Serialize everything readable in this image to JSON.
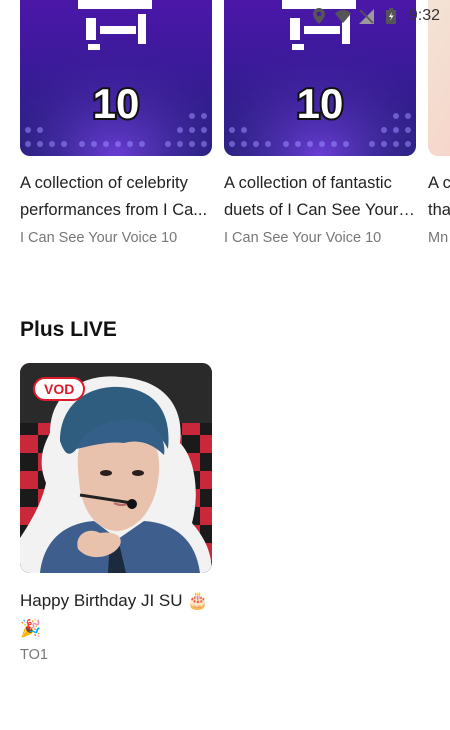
{
  "status_bar": {
    "time": "9:32"
  },
  "carousel": {
    "cards": [
      {
        "title": "A collection of celebrity performances from I Ca...",
        "subtitle": "I Can See Your Voice 10",
        "thumb_text": "10"
      },
      {
        "title": "A collection of fantastic duets of I Can See Your ...",
        "subtitle": "I Can See Your Voice 10",
        "thumb_text": "10"
      },
      {
        "title": "A c tha",
        "subtitle": "Mn"
      }
    ]
  },
  "plus_live": {
    "section_title": "Plus LIVE",
    "items": [
      {
        "badge": "VOD",
        "title": "Happy Birthday JI SU 🎂 🎉",
        "subtitle": "TO1"
      }
    ]
  }
}
